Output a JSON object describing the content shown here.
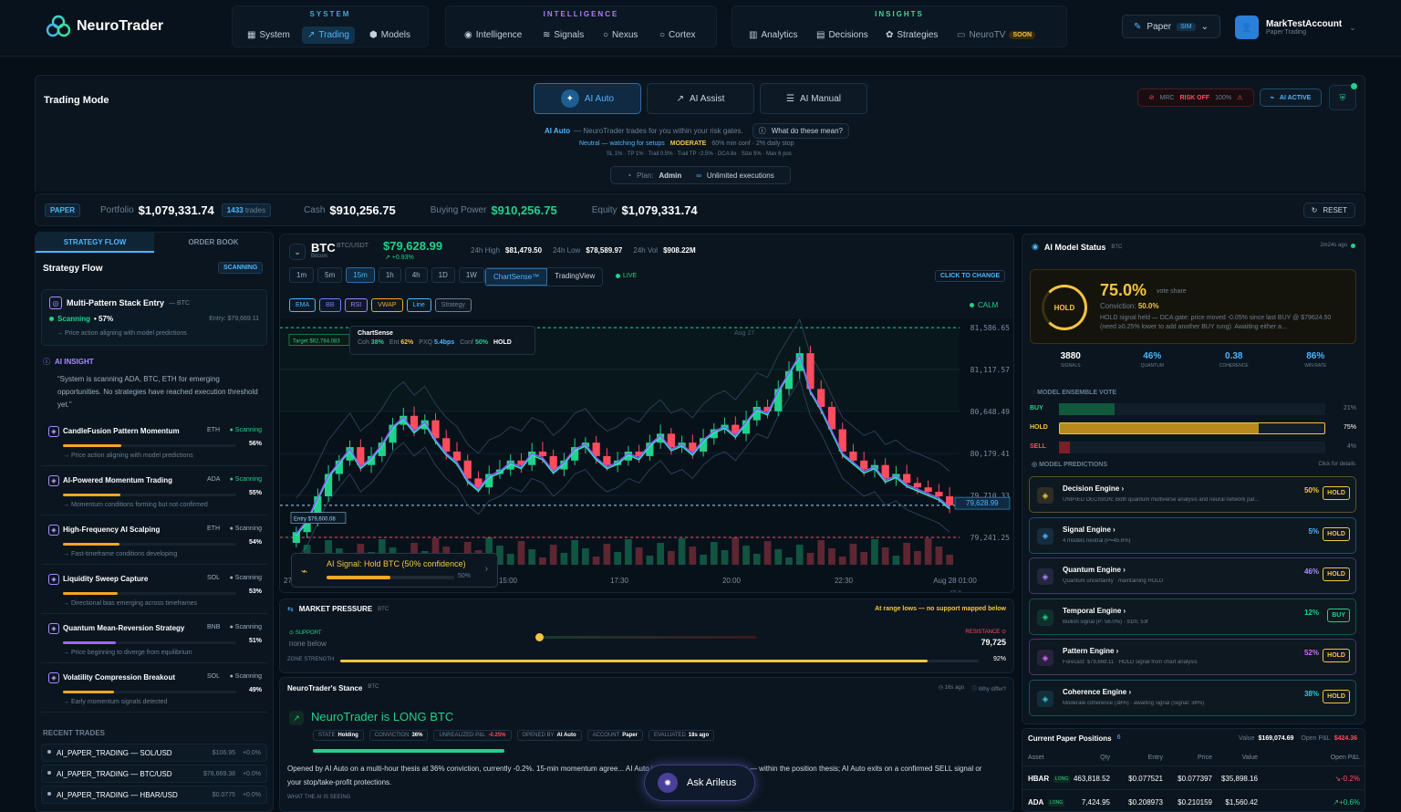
{
  "brand": {
    "name": "NeuroTrader"
  },
  "nav": {
    "system": {
      "label": "SYSTEM",
      "items": [
        "System",
        "Trading",
        "Models"
      ]
    },
    "intelligence": {
      "label": "INTELLIGENCE",
      "items": [
        "Intelligence",
        "Signals",
        "Nexus",
        "Cortex"
      ]
    },
    "insights": {
      "label": "INSIGHTS",
      "items": [
        "Analytics",
        "Decisions",
        "Strategies",
        "NeuroTV"
      ],
      "soon": "SOON"
    },
    "paper": "Paper",
    "sim": "SIM",
    "account": {
      "name": "MarkTestAccount",
      "sub": "Paper Trading"
    }
  },
  "mode": {
    "title": "Trading Mode",
    "auto": "AI Auto",
    "assist": "AI Assist",
    "manual": "AI Manual",
    "mrc": "MRC",
    "risk": "RISK OFF",
    "risk_pct": "100%",
    "active": "AI ACTIVE",
    "desc_a": "AI Auto",
    "desc_b": " — NeuroTrader trades for you within your risk gates.",
    "what": "What do these mean?",
    "line2_a": "Neutral — watching for setups",
    "line2_b": "MODERATE",
    "line2_c": "60% min conf · 2% daily stop",
    "line3": "SL 1% · TP 1% · Trail 0.5% · Trail TP ↑2.5% · DCA 8x · Size 5% · Max 6 pos",
    "plan_label": "Plan:",
    "plan": "Admin",
    "unlimited": "Unlimited executions"
  },
  "portfolio": {
    "paper": "PAPER",
    "portfolio_label": "Portfolio",
    "portfolio": "$1,079,331.74",
    "trades": "1433",
    "trades_label": "trades",
    "cash_label": "Cash",
    "cash": "$910,256.75",
    "bp_label": "Buying Power",
    "bp": "$910,256.75",
    "eq_label": "Equity",
    "eq": "$1,079,331.74",
    "reset": "RESET"
  },
  "left": {
    "tab1": "STRATEGY FLOW",
    "tab2": "ORDER BOOK",
    "title": "Strategy Flow",
    "scanning": "SCANNING",
    "top": {
      "name": "Multi-Pattern Stack Entry",
      "sym": "— BTC",
      "status": "Scanning",
      "pct": "• 57%",
      "entry": "Entry: $79,669.11",
      "note": "→ Price action aligning with model predictions"
    },
    "insight_title": "AI INSIGHT",
    "insight": "“System is scanning ADA, BTC, ETH for emerging opportunities. No strategies have reached execution threshold yet.”",
    "strategies": [
      {
        "name": "CandleFusion Pattern Momentum",
        "sym": "ETH",
        "status": "Scanning",
        "pct": "56%",
        "note": "→ Price action aligning with model predictions",
        "fill": 0.56,
        "color": "#f5a623",
        "icon": "candle-icon"
      },
      {
        "name": "AI-Powered Momentum Trading",
        "sym": "ADA",
        "status": "Scanning",
        "pct": "55%",
        "note": "→ Momentum conditions forming but not confirmed",
        "fill": 0.55,
        "color": "#f5a623",
        "icon": "chip-icon"
      },
      {
        "name": "High-Frequency AI Scalping",
        "sym": "ETH",
        "status": "Scanning",
        "pct": "54%",
        "note": "→ Fast-timeframe conditions developing",
        "fill": 0.54,
        "color": "#f5a623",
        "icon": "bolt-icon"
      },
      {
        "name": "Liquidity Sweep Capture",
        "sym": "SOL",
        "status": "Scanning",
        "pct": "53%",
        "note": "→ Directional bias emerging across timeframes",
        "fill": 0.53,
        "color": "#f5a623",
        "icon": "eye-icon"
      },
      {
        "name": "Quantum Mean-Reversion Strategy",
        "sym": "BNB",
        "status": "Scanning",
        "pct": "51%",
        "note": "→ Price beginning to diverge from equilibrium",
        "fill": 0.51,
        "color": "#9b6bff",
        "icon": "grid-icon"
      },
      {
        "name": "Volatility Compression Breakout",
        "sym": "SOL",
        "status": "Scanning",
        "pct": "49%",
        "note": "→ Early momentum signals detected",
        "fill": 0.49,
        "color": "#f5a623",
        "icon": "wave-icon"
      }
    ],
    "recent_title": "RECENT TRADES",
    "recent": [
      {
        "name": "AI_PAPER_TRADING — SOL/USD",
        "price": "$106.95",
        "chg": "+0.0%"
      },
      {
        "name": "AI_PAPER_TRADING — BTC/USD",
        "price": "$78,669.38",
        "chg": "+0.0%"
      },
      {
        "name": "AI_PAPER_TRADING — HBAR/USD",
        "price": "$0.0775",
        "chg": "+0.0%"
      }
    ]
  },
  "chart": {
    "sym": "BTC",
    "pair": "BTC/USDT",
    "name": "Bitcoin",
    "price": "$79,628.99",
    "chg": "↗ +0.93%",
    "high_label": "24h High",
    "high": "$81,479.50",
    "low_label": "24h Low",
    "low": "$78,589.97",
    "vol_label": "24h Vol",
    "vol": "$908.22M",
    "timeframes": [
      "1m",
      "5m",
      "15m",
      "1h",
      "4h",
      "1D",
      "1W"
    ],
    "cs": "ChartSense™",
    "tv": "TradingView",
    "live": "LIVE",
    "change": "CLICK TO CHANGE",
    "indicators": [
      "EMA",
      "BB",
      "RSI",
      "VWAP",
      "Line",
      "Strategy"
    ],
    "calm": "CALM",
    "target": "Target $82,784.083",
    "entry": "Entry $79,600.08",
    "stop": "Stop $78,006.078",
    "csbox": {
      "title": "ChartSense",
      "coh": "38%",
      "ent": "62%",
      "pxq": "5.4bps",
      "conf": "50%",
      "hold": "HOLD"
    },
    "ticks": [
      "81,586.65",
      "81,117.57",
      "80,648.49",
      "80,179.41",
      "79,710.33",
      "79,241.25"
    ],
    "cur": "79,628.99",
    "xticks": [
      "27",
      "12:30",
      "15:00",
      "17:30",
      "20:00",
      "22:30",
      "Aug 28 01:00"
    ],
    "aug27": "Aug 27",
    "signal": "AI Signal: Hold BTC (50% confidence)",
    "signal_pct": "50%",
    "rsi": "55.2"
  },
  "chart_data": {
    "type": "candlestick",
    "title": "BTC",
    "y_ticks": [
      81586.65,
      81117.57,
      80648.49,
      80179.41,
      79710.33,
      79241.25
    ],
    "x_ticks": [
      "27",
      "12:30",
      "15:00",
      "17:30",
      "20:00",
      "22:30",
      "Aug 28 01:00"
    ],
    "close": [
      79300,
      79450,
      79700,
      79950,
      80100,
      80250,
      80050,
      80150,
      80300,
      80500,
      80600,
      80450,
      80550,
      80350,
      80200,
      80100,
      79900,
      79800,
      79950,
      80000,
      80100,
      80050,
      80200,
      80150,
      80000,
      80100,
      80250,
      80300,
      80150,
      80050,
      80100,
      80200,
      80150,
      80300,
      80400,
      80250,
      80300,
      80200,
      80350,
      80450,
      80500,
      80400,
      80550,
      80700,
      80650,
      80900,
      81100,
      81300,
      80900,
      80700,
      80450,
      80200,
      80100,
      80000,
      80050,
      79900,
      79950,
      79850,
      79800,
      79750,
      79700,
      79600
    ]
  },
  "pressure": {
    "title": "MARKET PRESSURE",
    "sym": "BTC",
    "alert": "At range lows — no support mapped below",
    "support_label": "SUPPORT",
    "support": "none below",
    "res_label": "RESISTANCE",
    "res": "79,725",
    "zone_label": "ZONE STRENGTH",
    "zone": "92%",
    "zone_fill": 0.92
  },
  "stance": {
    "title": "NeuroTrader's Stance",
    "sym": "BTC",
    "ago": "16s ago",
    "why": "Why differ?",
    "head": "NeuroTrader is LONG BTC",
    "chips": [
      [
        "STATE",
        "Holding"
      ],
      [
        "CONVICTION",
        "36%"
      ],
      [
        "UNREALIZED P&L",
        "-0.25%"
      ],
      [
        "OPENED BY",
        "AI Auto"
      ],
      [
        "ACCOUNT",
        "Paper"
      ],
      [
        "EVALUATED",
        "18s ago"
      ]
    ],
    "text": "Opened by AI Auto on a multi-hour thesis at 36% conviction, currently -0.2%. 15-min momentum agree... AI Auto is choosing to hold — Holding — within the position thesis; AI Auto exits on a confirmed SELL signal or your stop/take-profit protections.",
    "seeing": "WHAT THE AI IS SEEING",
    "ask": "Ask Arileus"
  },
  "right": {
    "title": "AI Model Status",
    "sym": "BTC",
    "ago": "2m24s ago",
    "hold": "HOLD",
    "share": "75.0%",
    "share_label": "vote share",
    "conv_label": "Conviction:",
    "conv": "50.0%",
    "desc": "HOLD signal held — DCA gate: price moved -0.05% since last BUY @ $79624.50 (need ≥0.25% lower to add another BUY rung). Awaiting either a...",
    "stats": [
      [
        "3880",
        "SIGNALS"
      ],
      [
        "46%",
        "QUANTUM"
      ],
      [
        "0.38",
        "COHERENCE"
      ],
      [
        "86%",
        "WIN RATE"
      ]
    ],
    "vote_title": "MODEL ENSEMBLE VOTE",
    "votes": [
      [
        "BUY",
        "21%",
        0.21,
        "#22d18b"
      ],
      [
        "HOLD",
        "75%",
        0.75,
        "#f5c542"
      ],
      [
        "SELL",
        "4%",
        0.04,
        "#ff4d5e"
      ]
    ],
    "pred_title": "MODEL PREDICTIONS",
    "pred_hint": "Click for details",
    "engines": [
      {
        "name": "Decision Engine",
        "desc": "UNIFIED DECISION: Both quantum multiverse analysis and neural network pat...",
        "pct": "50%",
        "sig": "HOLD",
        "color": "#f5c542",
        "icon": "target-icon"
      },
      {
        "name": "Signal Engine",
        "desc": "4 models neutral (P=45.6%)",
        "pct": "5%",
        "sig": "HOLD",
        "color": "#4fb6ff",
        "icon": "signal-icon"
      },
      {
        "name": "Quantum Engine",
        "desc": "Quantum uncertainty · maintaining HOLD",
        "pct": "46%",
        "sig": "HOLD",
        "color": "#a98bff",
        "icon": "atom-icon"
      },
      {
        "name": "Temporal Engine",
        "desc": "Bullish signal (P: 56.0%) · 91m, 53f",
        "pct": "12%",
        "sig": "BUY",
        "color": "#22d18b",
        "icon": "clock-icon"
      },
      {
        "name": "Pattern Engine",
        "desc": "Forecast: $79,669.11 · HOLD signal from chart analysis",
        "pct": "52%",
        "sig": "HOLD",
        "color": "#d86bff",
        "icon": "eye-icon"
      },
      {
        "name": "Coherence Engine",
        "desc": "Moderate coherence (38%) · awaiting signal (Signal: 38%)",
        "pct": "38%",
        "sig": "HOLD",
        "color": "#36c5d6",
        "icon": "wave-icon"
      }
    ],
    "pos_title": "Current Paper Positions",
    "pos_count": "6",
    "pos_value_label": "Value",
    "pos_value": "$169,074.69",
    "pos_pnl_label": "Open P&L",
    "pos_pnl": "$424.36",
    "pos_headers": [
      "Asset",
      "Qty",
      "Entry",
      "Price",
      "Value",
      "Open P&L"
    ],
    "positions": [
      [
        "HBAR",
        "LONG",
        "463,818.52",
        "$0.077521",
        "$0.077397",
        "$35,898.16",
        "-0.2%"
      ],
      [
        "ADA",
        "LONG",
        "7,424.95",
        "$0.208973",
        "$0.210159",
        "$1,560.42",
        "+0.6%"
      ]
    ]
  }
}
